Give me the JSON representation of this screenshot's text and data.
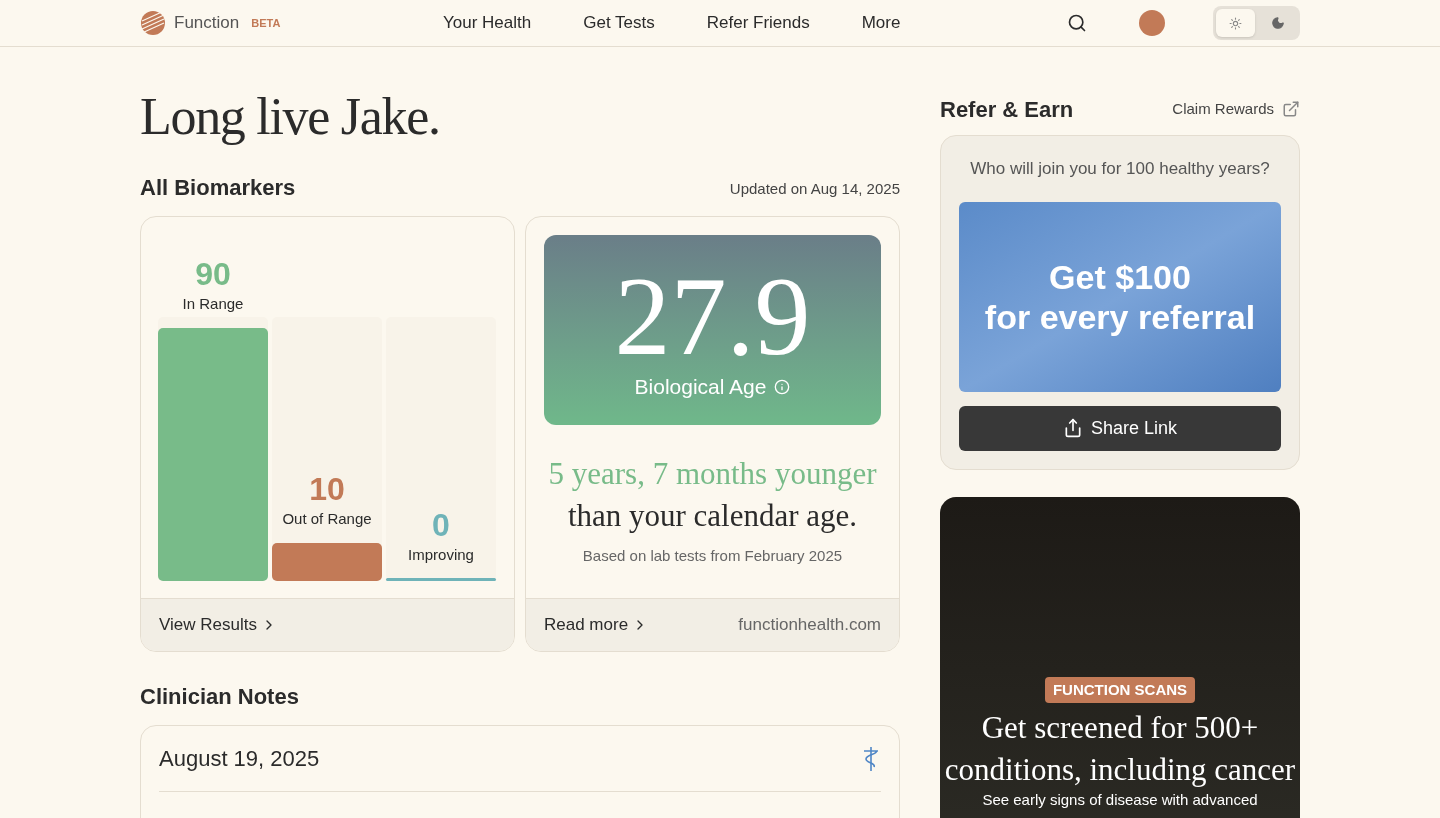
{
  "brand": {
    "name": "Function",
    "badge": "BETA"
  },
  "nav": [
    "Your Health",
    "Get Tests",
    "Refer Friends",
    "More"
  ],
  "theme_toggle": [
    {
      "kind": "sun",
      "selected": true
    },
    {
      "kind": "moon",
      "selected": false
    }
  ],
  "greeting": "Long live Jake.",
  "biomarkers": {
    "title": "All Biomarkers",
    "updated": "Updated on Aug 14, 2025",
    "groups": [
      {
        "count": "90",
        "label": "In Range",
        "level": 0.96,
        "color": "#78bb89"
      },
      {
        "count": "10",
        "label": "Out of Range",
        "level": 0.145,
        "color": "#c27a57"
      },
      {
        "count": "0",
        "label": "Improving",
        "level": 0.011,
        "color": "#6fb3b8"
      }
    ],
    "link": "View Results"
  },
  "bio_age": {
    "value": "27.9",
    "label": "Biological Age",
    "highlight": "5 years, 7 months younger",
    "rest": "than your calendar age.",
    "note": "Based on lab tests from February 2025",
    "link": "Read more",
    "source": "functionhealth.com"
  },
  "clinician_notes": {
    "title": "Clinician Notes",
    "date": "August 19, 2025"
  },
  "refer": {
    "title": "Refer & Earn",
    "claim": "Claim Rewards",
    "question": "Who will join you for 100 healthy years?",
    "banner": [
      "Get $100",
      "for every referral"
    ],
    "button": "Share Link"
  },
  "promo": {
    "tag": "FUNCTION SCANS",
    "headline": [
      "Get screened for 500+",
      "conditions, including cancer"
    ],
    "sub": "See early signs of disease with advanced"
  }
}
